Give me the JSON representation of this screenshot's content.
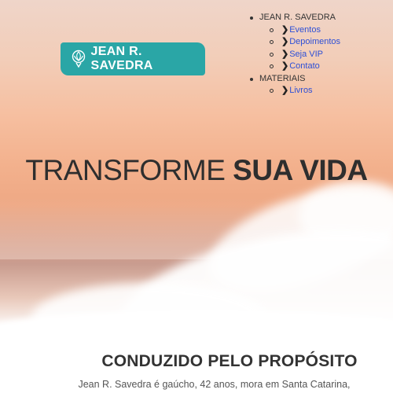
{
  "logo": {
    "text": "JEAN R. SAVEDRA",
    "icon": "lotus-icon",
    "color": "#2aa6a6"
  },
  "nav": {
    "group1": {
      "label": "JEAN R. SAVEDRA",
      "items": [
        "Eventos",
        "Depoimentos",
        "Seja VIP",
        "Contato"
      ]
    },
    "group2": {
      "label": "MATERIAIS",
      "items": [
        "Livros"
      ]
    },
    "link_color": "#2d4fd6"
  },
  "hero": {
    "headline_light": "TRANSFORME",
    "headline_bold": "SUA VIDA"
  },
  "section": {
    "title": "CONDUZIDO PELO PROPÓSITO",
    "intro": "Jean R. Savedra é gaúcho, 42 anos, mora em Santa Catarina,"
  }
}
